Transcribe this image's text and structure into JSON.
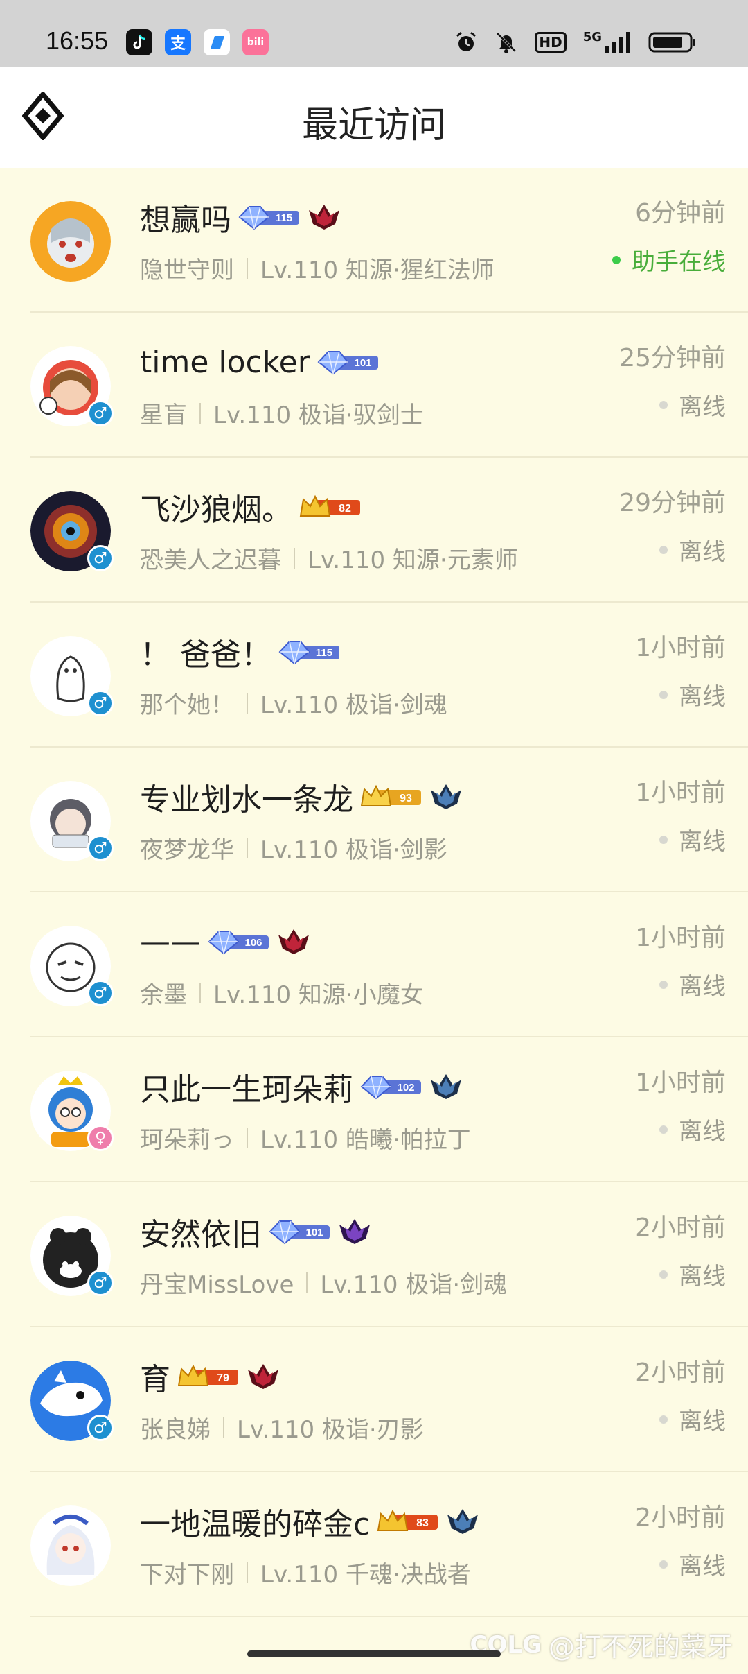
{
  "status_bar": {
    "time": "16:55",
    "apps": [
      "tiktok-icon",
      "alipay-icon",
      "blue-app-icon",
      "bilibili-icon"
    ],
    "system": [
      "alarm-icon",
      "mute-icon",
      "hd-icon",
      "5g-signal-icon",
      "battery-icon"
    ],
    "hd_label": "HD",
    "net_label": "5G"
  },
  "nav": {
    "title": "最近访问"
  },
  "visitors": [
    {
      "name": "想赢吗",
      "badge_num": "115",
      "badge_type": "diamond",
      "rank": "red",
      "server": "隐世守则",
      "level": "Lv.110 知源·猩红法师",
      "time": "6分钟前",
      "status": "助手在线",
      "online": true,
      "gender": "",
      "avatar_bg": "#f6a623"
    },
    {
      "name": "time locker",
      "badge_num": "101",
      "badge_type": "diamond",
      "rank": "",
      "server": "星盲",
      "level": "Lv.110 极诣·驭剑士",
      "time": "25分钟前",
      "status": "离线",
      "online": false,
      "gender": "♂",
      "avatar_bg": "#ffffff"
    },
    {
      "name": "飞沙狼烟。",
      "badge_num": "82",
      "badge_type": "crown",
      "rank": "",
      "server": "恐美人之迟暮",
      "level": "Lv.110 知源·元素师",
      "time": "29分钟前",
      "status": "离线",
      "online": false,
      "gender": "♂",
      "avatar_bg": "#1a1a2e"
    },
    {
      "name": "！ 爸爸！",
      "badge_num": "115",
      "badge_type": "diamond",
      "rank": "",
      "server": "那个她！",
      "level": "Lv.110 极诣·剑魂",
      "time": "1小时前",
      "status": "离线",
      "online": false,
      "gender": "♂",
      "avatar_bg": "#ffffff"
    },
    {
      "name": "专业划水一条龙",
      "badge_num": "93",
      "badge_type": "gold",
      "rank": "blue",
      "server": "夜梦龙华",
      "level": "Lv.110 极诣·剑影",
      "time": "1小时前",
      "status": "离线",
      "online": false,
      "gender": "♂",
      "avatar_bg": "#ffffff"
    },
    {
      "name": "——",
      "badge_num": "106",
      "badge_type": "diamond",
      "rank": "red",
      "server": "余墨",
      "level": "Lv.110 知源·小魔女",
      "time": "1小时前",
      "status": "离线",
      "online": false,
      "gender": "♂",
      "avatar_bg": "#ffffff"
    },
    {
      "name": "只此一生珂朵莉",
      "badge_num": "102",
      "badge_type": "diamond",
      "rank": "blue",
      "server": "珂朵莉っ",
      "level": "Lv.110 皓曦·帕拉丁",
      "time": "1小时前",
      "status": "离线",
      "online": false,
      "gender": "♀",
      "avatar_bg": "#ffffff"
    },
    {
      "name": "安然依旧",
      "badge_num": "101",
      "badge_type": "diamond",
      "rank": "purple",
      "server": "丹宝MissLove",
      "level": "Lv.110 极诣·剑魂",
      "time": "2小时前",
      "status": "离线",
      "online": false,
      "gender": "♂",
      "avatar_bg": "#222222"
    },
    {
      "name": "育",
      "badge_num": "79",
      "badge_type": "crown",
      "rank": "red",
      "server": "张良娣",
      "level": "Lv.110 极诣·刃影",
      "time": "2小时前",
      "status": "离线",
      "online": false,
      "gender": "♂",
      "avatar_bg": "#2c7be5"
    },
    {
      "name": "一地温暖的碎金c",
      "badge_num": "83",
      "badge_type": "crown",
      "rank": "blue",
      "server": "下对下刚",
      "level": "Lv.110 千魂·决战者",
      "time": "2小时前",
      "status": "离线",
      "online": false,
      "gender": "",
      "avatar_bg": "#ffffff"
    }
  ],
  "watermark": {
    "logo": "COLG",
    "text": "@打不死的菜牙"
  },
  "colors": {
    "online": "#48ad3a",
    "offline_dot": "#d8d8d0",
    "background": "#fdfbe4",
    "male": "#1e90d0",
    "female": "#ef7dab"
  }
}
